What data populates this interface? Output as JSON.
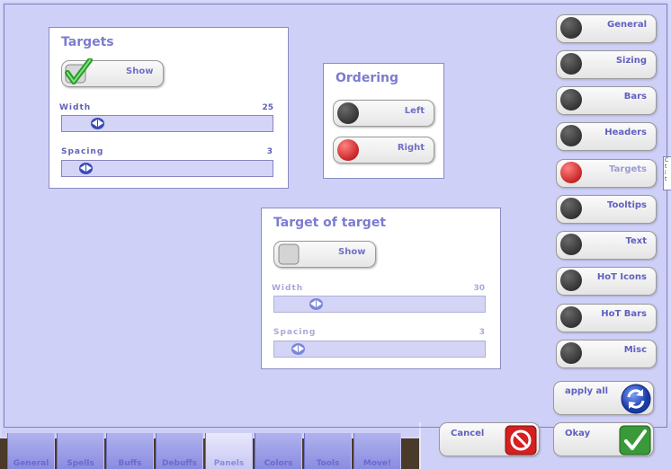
{
  "targets": {
    "title": "Targets",
    "show_label": "Show",
    "show_checked": true,
    "width": {
      "label": "Width",
      "value": "25",
      "fraction": 0.14
    },
    "spacing": {
      "label": "Spacing",
      "value": "3",
      "fraction": 0.08
    }
  },
  "ordering": {
    "title": "Ordering",
    "left_label": "Left",
    "right_label": "Right",
    "selected": "Right"
  },
  "target_of_target": {
    "title": "Target of target",
    "show_label": "Show",
    "show_checked": false,
    "width": {
      "label": "Width",
      "value": "30",
      "fraction": 0.17
    },
    "spacing": {
      "label": "Spacing",
      "value": "3",
      "fraction": 0.08
    }
  },
  "nav": {
    "items": [
      {
        "label": "General",
        "active": false
      },
      {
        "label": "Sizing",
        "active": false
      },
      {
        "label": "Bars",
        "active": false
      },
      {
        "label": "Headers",
        "active": false
      },
      {
        "label": "Targets",
        "active": true
      },
      {
        "label": "Tooltips",
        "active": false
      },
      {
        "label": "Text",
        "active": false
      },
      {
        "label": "HoT Icons",
        "active": false
      },
      {
        "label": "HoT Bars",
        "active": false
      },
      {
        "label": "Misc",
        "active": false
      }
    ]
  },
  "actions": {
    "apply_all_label": "apply all",
    "cancel_label": "Cancel",
    "okay_label": "Okay"
  },
  "tabs": [
    {
      "label": "General",
      "active": false
    },
    {
      "label": "Spells",
      "active": false
    },
    {
      "label": "Buffs",
      "active": false
    },
    {
      "label": "Debuffs",
      "active": false
    },
    {
      "label": "Panels",
      "active": true
    },
    {
      "label": "Colors",
      "active": false
    },
    {
      "label": "Tools",
      "active": false
    },
    {
      "label": "Move!",
      "active": false
    }
  ],
  "edge_tooltip": {
    "lines": [
      "C",
      "t",
      "i",
      "t"
    ]
  },
  "colors": {
    "panel": "#cfd0f7",
    "accent": "#7c7cd0",
    "active_led": "#d00000"
  }
}
